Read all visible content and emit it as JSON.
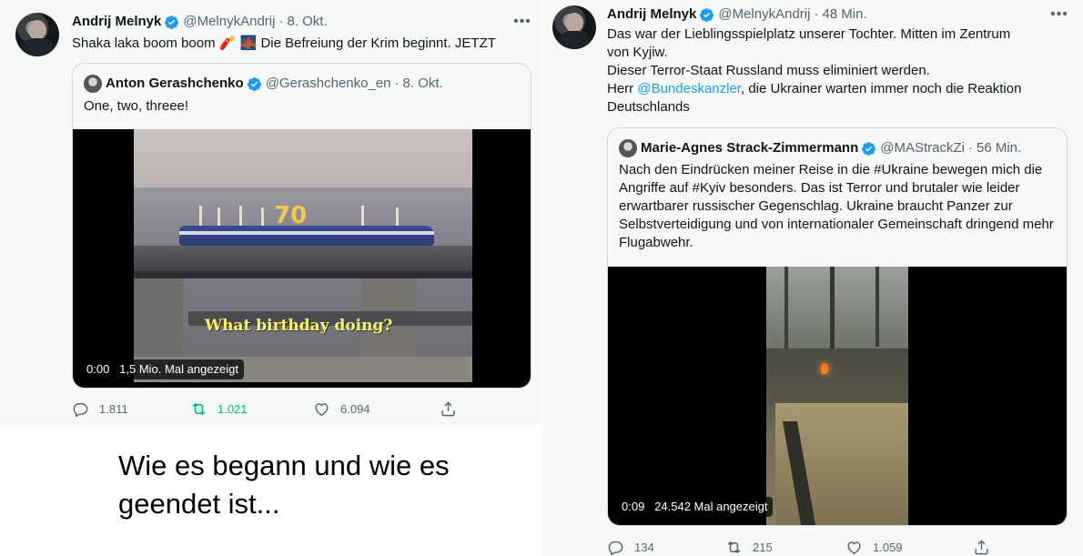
{
  "left_tweet": {
    "author_name": "Andrij Melnyk",
    "handle": "@MelnykAndrij",
    "separator": "·",
    "time": "8. Okt.",
    "text_before": "Shaka laka boom boom ",
    "emoji": "🧨 🌉",
    "text_after": " Die Befreiung der Krim beginnt. JETZT",
    "quote": {
      "author_name": "Anton Gerashchenko",
      "handle": "@Gerashchenko_en",
      "separator": "·",
      "time": "8. Okt.",
      "text": "One, two, threee!",
      "video_time": "0:00",
      "video_views": "1,5 Mio. Mal angezeigt",
      "video_overlay": "What birthday doing?",
      "video_cake_number": "70"
    },
    "stats": {
      "replies": "1.811",
      "retweets": "1.021",
      "likes": "6.094"
    }
  },
  "caption": {
    "text": "Wie es begann und wie es geendet ist..."
  },
  "right_tweet": {
    "author_name": "Andrij Melnyk",
    "handle": "@MelnykAndrij",
    "separator": "·",
    "time": "48 Min.",
    "line1": "Das war der Lieblingsspielplatz unserer Tochter. Mitten im Zentrum von Kyjiw.",
    "line2": "Dieser Terror-Staat Russland muss eliminiert werden.",
    "line3_before": "Herr ",
    "mention": "@Bundeskanzler",
    "line3_after": ", die Ukrainer warten immer noch die Reaktion Deutschlands",
    "quote": {
      "author_name": "Marie-Agnes Strack-Zimmermann",
      "handle": "@MAStrackZi",
      "separator": "·",
      "time": "56 Min.",
      "text": "Nach den Eindrücken meiner Reise in die #Ukraine bewegen mich die Angriffe auf #Kyiv besonders. Das ist Terror und brutaler wie leider erwartbarer russischer Gegenschlag. Ukraine braucht Panzer zur Selbstverteidigung und von internationaler Gemeinschaft dringend mehr Flugabwehr.",
      "video_time": "0:09",
      "video_views": "24.542 Mal angezeigt"
    },
    "stats": {
      "replies": "134",
      "retweets": "215",
      "likes": "1.059"
    }
  },
  "icons": {
    "verified": "verified-badge-icon",
    "more": "more-options-icon",
    "reply": "reply-icon",
    "retweet": "retweet-icon",
    "like": "like-icon",
    "share": "share-icon"
  },
  "colors": {
    "accent": "#1d9bf0",
    "retweet_active": "#00ba7c",
    "secondary_text": "#536471",
    "panel_bg": "#f7f9f9"
  }
}
